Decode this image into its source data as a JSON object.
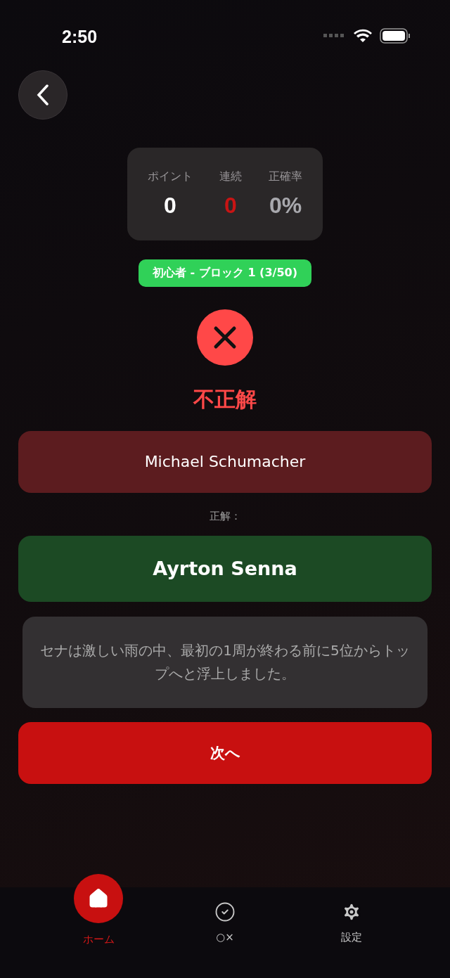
{
  "status_bar": {
    "time": "2:50"
  },
  "stats": [
    {
      "label": "ポイント",
      "value": "0",
      "color": "#ffffff"
    },
    {
      "label": "連続",
      "value": "0",
      "color": "#c81414"
    },
    {
      "label": "正確率",
      "value": "0%",
      "color": "#a8a8ad"
    }
  ],
  "level_badge": "初心者 - ブロック 1 (3/50)",
  "result": {
    "correct": false,
    "label": "不正解"
  },
  "your_answer": "Michael Schumacher",
  "correct_label": "正解：",
  "correct_answer": "Ayrton Senna",
  "explanation": "セナは激しい雨の中、最初の1周が終わる前に5位からトップへと浮上しました。",
  "next_button": "次へ",
  "tabs": [
    {
      "kind": "home",
      "label": "ホーム",
      "selected": true
    },
    {
      "kind": "quiz",
      "label": "○×",
      "selected": false
    },
    {
      "kind": "settings",
      "label": "設定",
      "selected": false
    }
  ]
}
